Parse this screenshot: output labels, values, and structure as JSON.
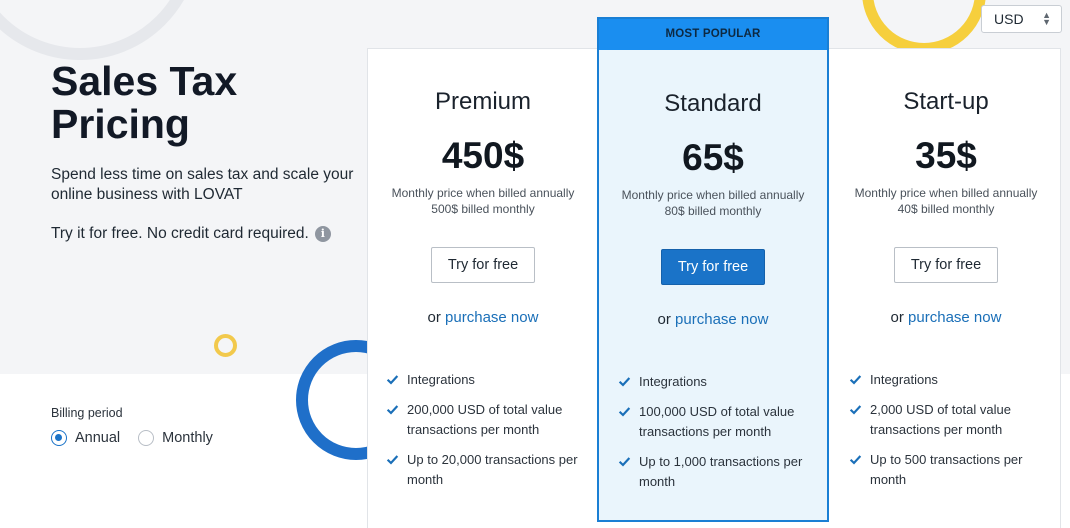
{
  "hero": {
    "title": "Sales Tax Pricing",
    "subtitle": "Spend less time on sales tax and scale your online business with LOVAT",
    "free_note": "Try it for free. No credit card required.",
    "info_icon": "info-icon"
  },
  "billing": {
    "label": "Billing period",
    "options": [
      {
        "label": "Annual",
        "selected": true
      },
      {
        "label": "Monthly",
        "selected": false
      }
    ]
  },
  "currency": {
    "value": "USD"
  },
  "purchase_prefix": "or",
  "plans": [
    {
      "name": "Premium",
      "price": "450$",
      "note_line1": "Monthly price when billed annually",
      "note_line2": "500$ billed monthly",
      "cta": "Try for free",
      "purchase_link": "purchase now",
      "features": [
        "Integrations",
        "200,000 USD of total value transactions per month",
        "Up to 20,000 transactions per month"
      ]
    },
    {
      "name": "Standard",
      "badge": "MOST POPULAR",
      "price": "65$",
      "note_line1": "Monthly price when billed annually",
      "note_line2": "80$ billed monthly",
      "cta": "Try for free",
      "purchase_link": "purchase now",
      "features": [
        "Integrations",
        "100,000 USD of total value transactions per month",
        "Up to 1,000 transactions per month"
      ]
    },
    {
      "name": "Start-up",
      "price": "35$",
      "note_line1": "Monthly price when billed annually",
      "note_line2": "40$ billed monthly",
      "cta": "Try for free",
      "purchase_link": "purchase now",
      "features": [
        "Integrations",
        "2,000 USD of total value transactions per month",
        "Up to 500 transactions per month"
      ]
    }
  ],
  "colors": {
    "accent": "#1a73c8",
    "popular_bg": "#eaf5fc",
    "popular_banner": "#1a8ef0",
    "hero_bg": "#f4f5f7"
  }
}
